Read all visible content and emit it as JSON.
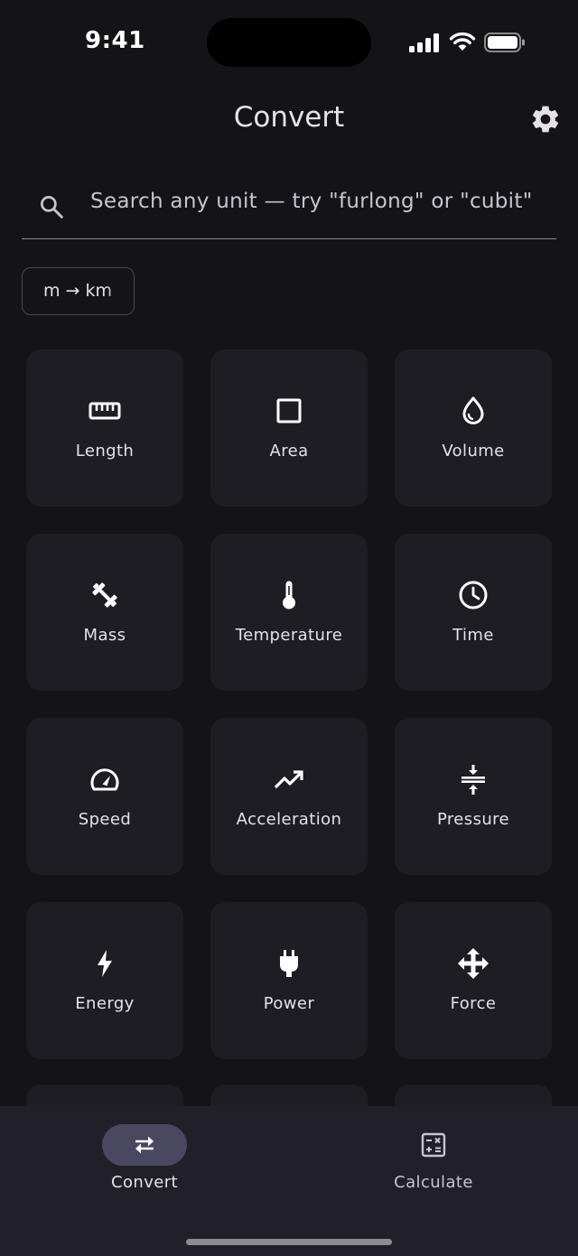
{
  "status_bar": {
    "time": "9:41"
  },
  "header": {
    "title": "Convert"
  },
  "search": {
    "placeholder": "Search any unit — try \"furlong\" or \"cubit\""
  },
  "recent_chip": {
    "label": "m → km"
  },
  "categories": [
    {
      "label": "Length",
      "icon": "ruler-icon"
    },
    {
      "label": "Area",
      "icon": "square-icon"
    },
    {
      "label": "Volume",
      "icon": "water-drop-icon"
    },
    {
      "label": "Mass",
      "icon": "fitness-center-icon"
    },
    {
      "label": "Temperature",
      "icon": "thermometer-icon"
    },
    {
      "label": "Time",
      "icon": "clock-icon"
    },
    {
      "label": "Speed",
      "icon": "speedometer-icon"
    },
    {
      "label": "Acceleration",
      "icon": "trending-up-icon"
    },
    {
      "label": "Pressure",
      "icon": "compress-icon"
    },
    {
      "label": "Energy",
      "icon": "bolt-icon"
    },
    {
      "label": "Power",
      "icon": "plug-icon"
    },
    {
      "label": "Force",
      "icon": "move-arrows-icon"
    }
  ],
  "bottom_nav": {
    "items": [
      {
        "label": "Convert",
        "icon": "swap-arrows-icon",
        "active": true
      },
      {
        "label": "Calculate",
        "icon": "calculator-icon",
        "active": false
      }
    ]
  },
  "colors": {
    "background": "#141318",
    "tile": "#1e1d24",
    "nav_bg": "#211f27",
    "active_pill": "#4a4760"
  }
}
